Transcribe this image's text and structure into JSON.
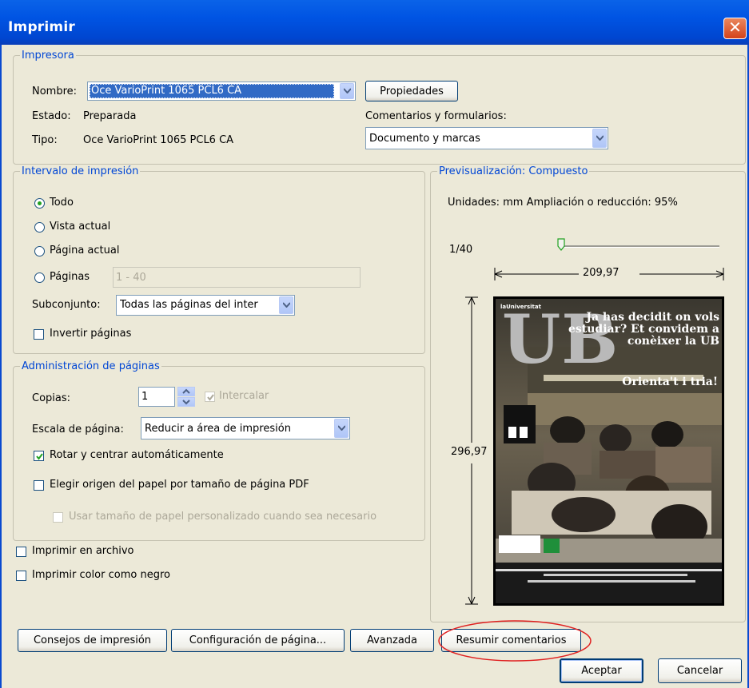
{
  "window": {
    "title": "Imprimir"
  },
  "printer": {
    "legend": "Impresora",
    "name_label": "Nombre:",
    "name_value": "Oce VarioPrint 1065 PCL6 CA",
    "properties_button": "Propiedades",
    "status_label": "Estado:",
    "status_value": "Preparada",
    "type_label": "Tipo:",
    "type_value": "Oce VarioPrint 1065 PCL6 CA",
    "comments_label": "Comentarios y formularios:",
    "comments_value": "Documento y marcas"
  },
  "range": {
    "legend": "Intervalo de impresión",
    "all": "Todo",
    "current_view": "Vista actual",
    "current_page": "Página actual",
    "pages": "Páginas",
    "pages_value": "1 - 40",
    "subset_label": "Subconjunto:",
    "subset_value": "Todas las páginas del inter",
    "reverse": "Invertir páginas"
  },
  "page_handling": {
    "legend": "Administración de páginas",
    "copies_label": "Copias:",
    "copies_value": "1",
    "collate": "Intercalar",
    "scale_label": "Escala de página:",
    "scale_value": "Reducir a área de impresión",
    "auto_rotate": "Rotar y centrar automáticamente",
    "paper_source": "Elegir origen del papel por tamaño de página PDF",
    "custom_paper": "Usar tamaño de papel personalizado cuando sea necesario"
  },
  "print_to_file": "Imprimir en archivo",
  "print_color_black": "Imprimir color como negro",
  "preview": {
    "legend": "Previsualización: Compuesto",
    "units_line": "Unidades: mm Ampliación o reducción:  95%",
    "page_counter": "1/40",
    "width": "209,97",
    "height": "296,97",
    "slider_level": 0.0,
    "poster": {
      "masthead": "laUniversitat",
      "big_letters": "UB",
      "headline": "Ja has decidit on vols estudiar? Et convidem a conèixer la UB",
      "cta": "Orienta't i tria!"
    }
  },
  "buttons": {
    "tips": "Consejos de impresión",
    "page_setup": "Configuración de página...",
    "advanced": "Avanzada",
    "summarize": "Resumir comentarios",
    "ok": "Aceptar",
    "cancel": "Cancelar"
  },
  "colors": {
    "titlebar": "#0054E3",
    "legend": "#0046D5",
    "annotation": "#E02020",
    "selection": "#316AC5"
  }
}
